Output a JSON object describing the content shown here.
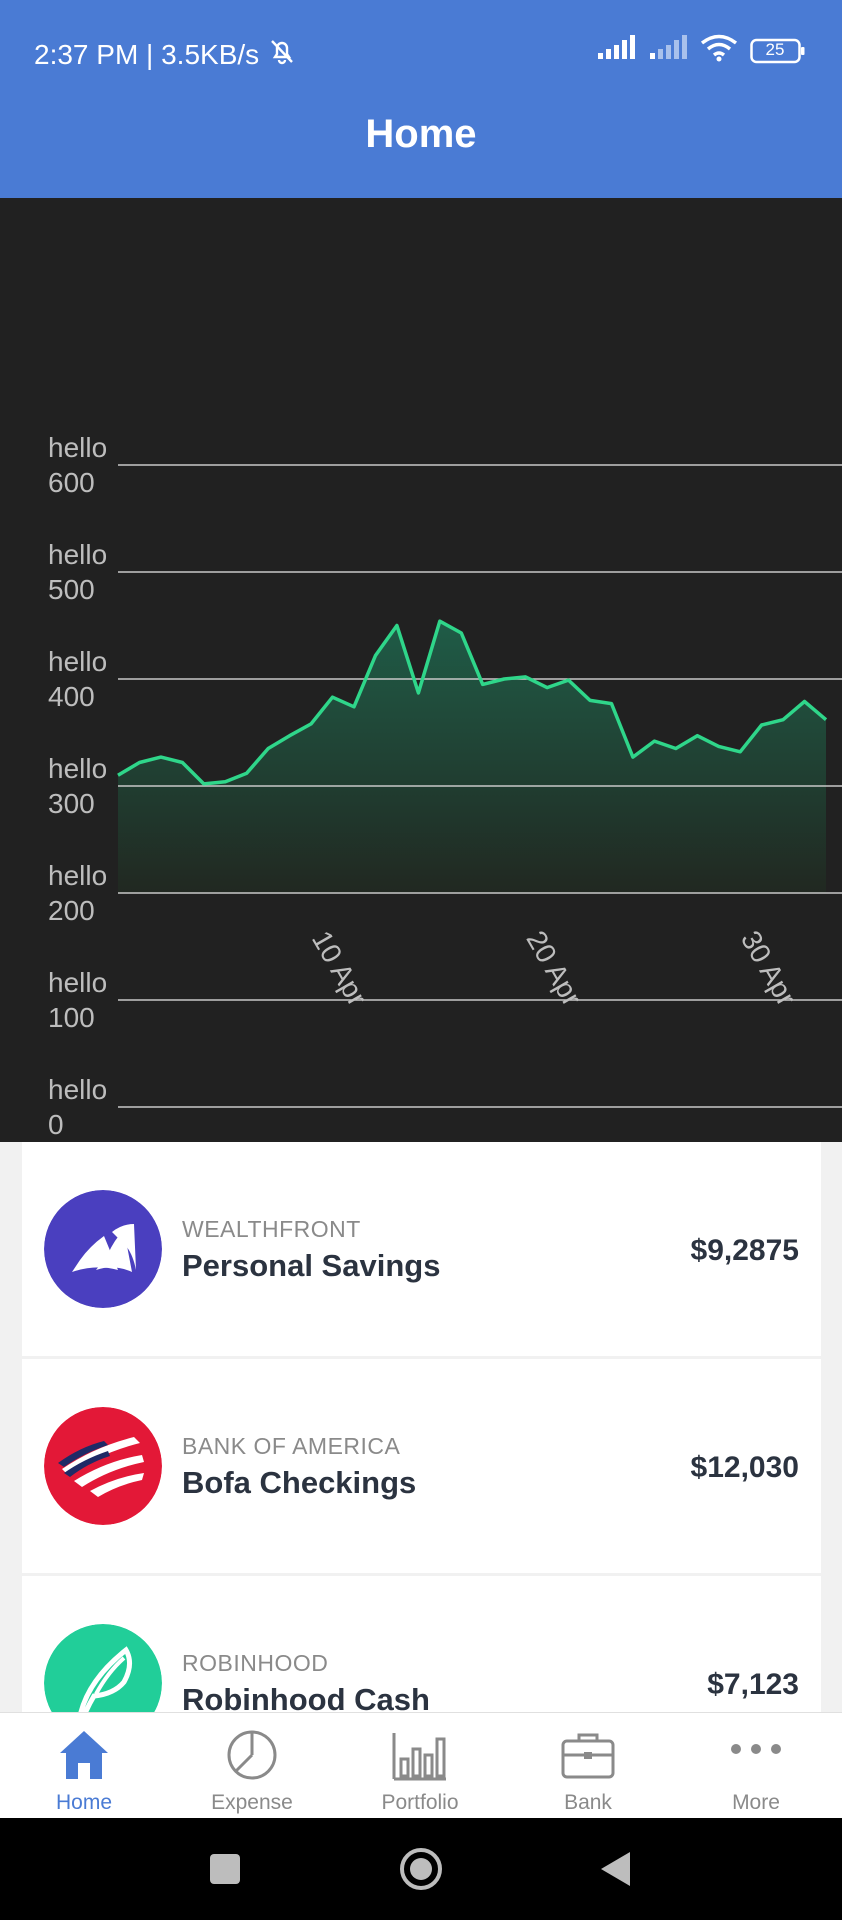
{
  "status_bar": {
    "time_speed": "2:37 PM | 3.5KB/s",
    "battery": "25"
  },
  "app_bar": {
    "title": "Home"
  },
  "chart_data": {
    "type": "area",
    "y_tick_labels": [
      [
        "hello",
        "600"
      ],
      [
        "hello",
        "500"
      ],
      [
        "hello",
        "400"
      ],
      [
        "hello",
        "300"
      ],
      [
        "hello",
        "200"
      ],
      [
        "hello",
        "100"
      ],
      [
        "hello",
        "0"
      ]
    ],
    "y_ticks": [
      600,
      500,
      400,
      300,
      200,
      100,
      0
    ],
    "x_tick_labels": [
      "10 Apr",
      "20 Apr",
      "30 Apr"
    ],
    "x_tick_days": [
      10,
      20,
      30
    ],
    "x_days": [
      1,
      2,
      3,
      4,
      5,
      6,
      7,
      8,
      9,
      10,
      11,
      12,
      13,
      14,
      15,
      16,
      17,
      18,
      19,
      20,
      21,
      22,
      23,
      24,
      25,
      26,
      27,
      28,
      29,
      30,
      31,
      32,
      33,
      34
    ],
    "values": [
      310,
      322,
      327,
      322,
      302,
      304,
      312,
      335,
      347,
      358,
      383,
      374,
      422,
      450,
      387,
      454,
      443,
      395,
      400,
      402,
      392,
      399,
      380,
      377,
      327,
      342,
      335,
      347,
      337,
      332,
      357,
      362,
      379,
      362
    ],
    "ylim": [
      0,
      600
    ],
    "colors": {
      "line": "#2fd68a",
      "fill_top": "#1f5c47",
      "fill_bottom": "#212821",
      "grid": "#c8c8c8",
      "label": "#bdbdbd"
    }
  },
  "accounts": [
    {
      "bank": "WEALTHFRONT",
      "name": "Personal Savings",
      "amount": "$9,2875",
      "logo_color": "#4a3fbf",
      "icon": "wealthfront-logo-icon"
    },
    {
      "bank": "BANK OF AMERICA",
      "name": "Bofa Checkings",
      "amount": "$12,030",
      "logo_color": "#e31837",
      "icon": "bank-of-america-logo-icon"
    },
    {
      "bank": "ROBINHOOD",
      "name": "Robinhood Cash",
      "amount": "$7,123",
      "logo_color": "#21ce99",
      "icon": "robinhood-logo-icon"
    }
  ],
  "tabs": [
    {
      "label": "Home",
      "icon": "home-icon",
      "active": true
    },
    {
      "label": "Expense",
      "icon": "pie-chart-icon",
      "active": false
    },
    {
      "label": "Portfolio",
      "icon": "bar-chart-icon",
      "active": false
    },
    {
      "label": "Bank",
      "icon": "briefcase-icon",
      "active": false
    },
    {
      "label": "More",
      "icon": "more-icon",
      "active": false
    }
  ],
  "colors": {
    "accent": "#4a7bd4",
    "inactive": "#8a8a8a"
  }
}
